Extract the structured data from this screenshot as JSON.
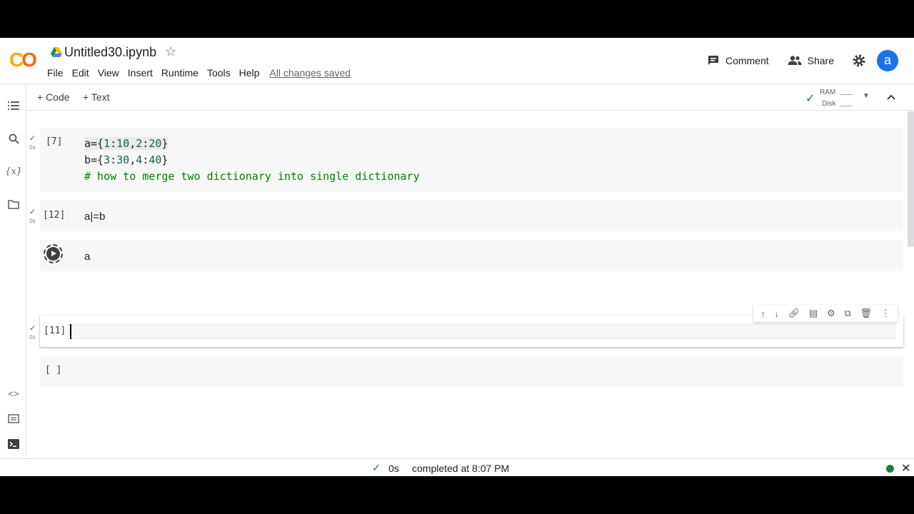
{
  "header": {
    "logo": "CO",
    "title": "Untitled30.ipynb",
    "menu": [
      "File",
      "Edit",
      "View",
      "Insert",
      "Runtime",
      "Tools",
      "Help"
    ],
    "save_status": "All changes saved",
    "comment_label": "Comment",
    "share_label": "Share",
    "avatar_letter": "a"
  },
  "toolbar": {
    "add_code": "+ Code",
    "add_text": "+ Text",
    "ram_label": "RAM",
    "disk_label": "Disk"
  },
  "cells": [
    {
      "exec": "[7]",
      "time": "0s",
      "lines": [
        "a={1:10,2:20}",
        "b={3:30,4:40}",
        "# how to merge two dictionary into single dictionary"
      ]
    },
    {
      "exec": "[12]",
      "time": "0s",
      "code": "a|=b"
    },
    {
      "code": "a",
      "state": "pending-run"
    },
    {
      "exec": "[11]",
      "time": "0s",
      "code": "",
      "active": true
    },
    {
      "exec": "[ ]",
      "code": ""
    }
  ],
  "status": {
    "duration": "0s",
    "message": "completed at 8:07 PM"
  },
  "colors": {
    "accent": "#1a73e8",
    "ok": "#188038",
    "logo_orange": "#f9ab00"
  }
}
